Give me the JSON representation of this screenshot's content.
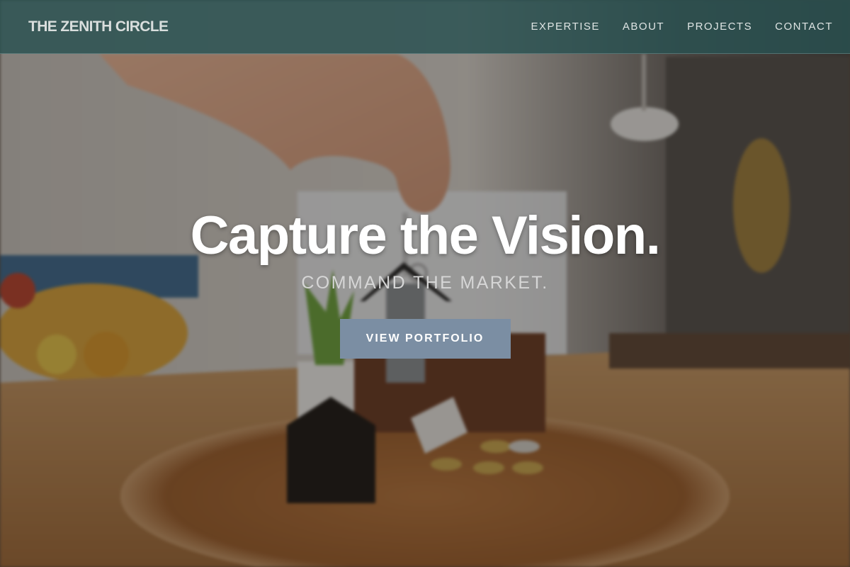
{
  "navbar": {
    "brand": "THE ZENITH CIRCLE",
    "links": [
      {
        "label": "EXPERTISE"
      },
      {
        "label": "ABOUT"
      },
      {
        "label": "PROJECTS"
      },
      {
        "label": "CONTACT"
      }
    ]
  },
  "hero": {
    "title": "Capture the Vision.",
    "subtitle": "COMMAND THE MARKET.",
    "cta_label": "VIEW PORTFOLIO",
    "background_image": "hand-holding-house-keys-photo"
  },
  "colors": {
    "navbar_bg": "#2c5a5a",
    "cta_bg": "#7b8ea3",
    "title_text": "#ffffff",
    "subtitle_text": "#d6d6d6"
  }
}
